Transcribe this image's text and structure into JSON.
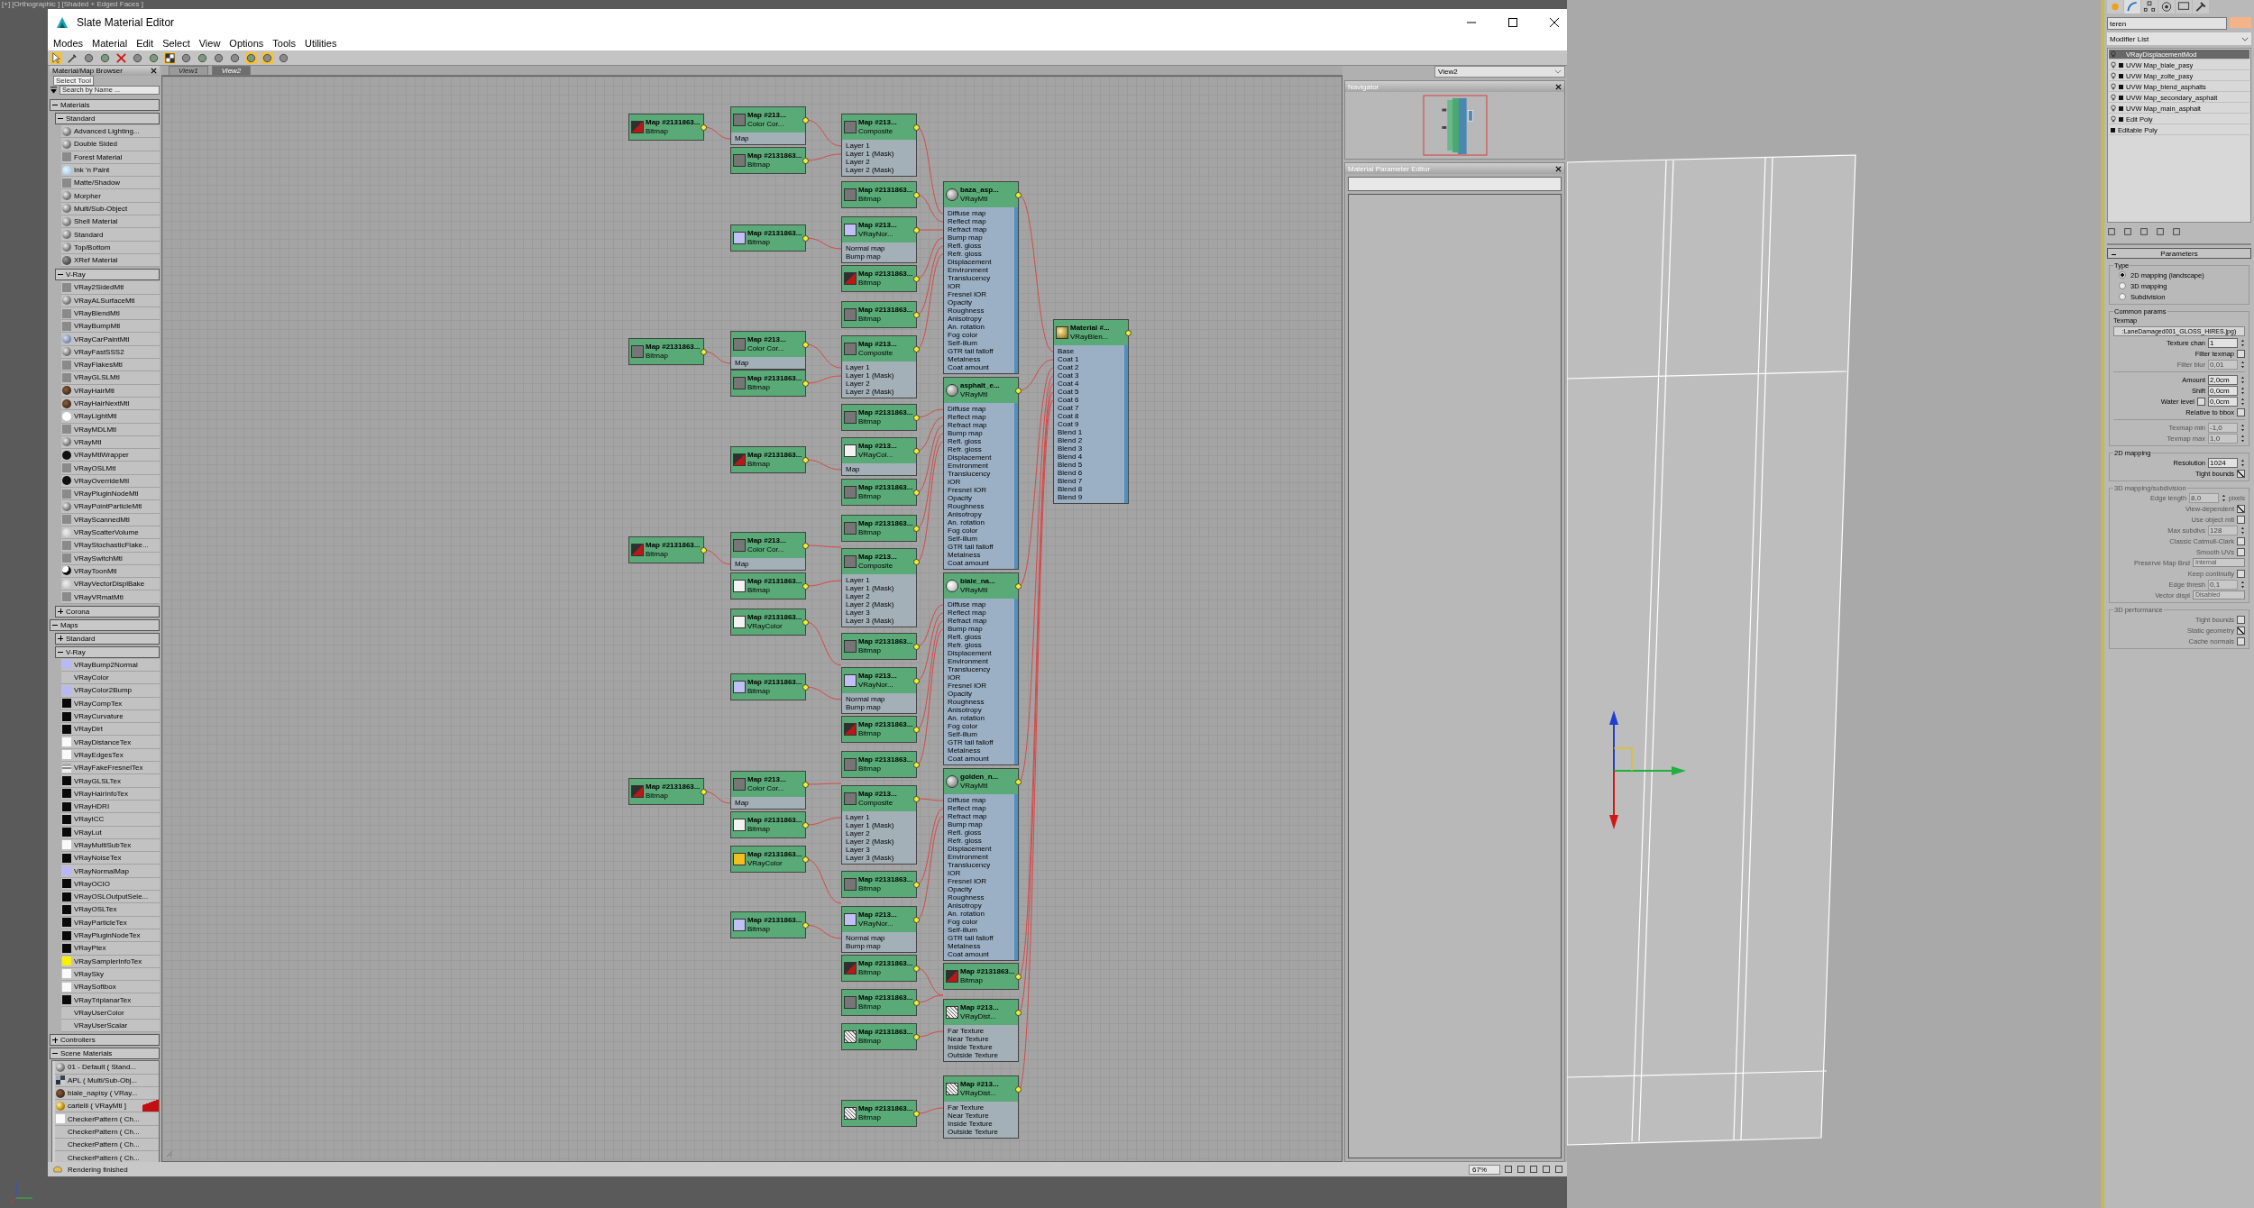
{
  "viewport": {
    "label": "[+] [Orthographic ] [Shaded + Edged Faces ]"
  },
  "window": {
    "title": "Slate Material Editor"
  },
  "menu": [
    "Modes",
    "Material",
    "Edit",
    "Select",
    "View",
    "Options",
    "Tools",
    "Utilities"
  ],
  "tooltip": "Select Tool",
  "browser": {
    "title": "Material/Map Browser",
    "search": {
      "placeholder": "Search by Name ..."
    },
    "sections": [
      {
        "label": "Materials",
        "expanded": true,
        "groups": [
          {
            "label": "Standard",
            "expanded": true,
            "items": [
              {
                "label": "Advanced Lighting...",
                "kind": "sphere"
              },
              {
                "label": "Double Sided",
                "kind": "sphere"
              },
              {
                "label": "Forest Material",
                "kind": "flat"
              },
              {
                "label": "Ink 'n Paint",
                "kind": "ink"
              },
              {
                "label": "Matte/Shadow",
                "kind": "flat"
              },
              {
                "label": "Morpher",
                "kind": "sphere"
              },
              {
                "label": "Multi/Sub-Object",
                "kind": "sphere"
              },
              {
                "label": "Shell Material",
                "kind": "sphere"
              },
              {
                "label": "Standard",
                "kind": "sphere"
              },
              {
                "label": "Top/Bottom",
                "kind": "sphere"
              },
              {
                "label": "XRef Material",
                "kind": "dark"
              }
            ]
          },
          {
            "label": "V-Ray",
            "expanded": true,
            "items": [
              {
                "label": "VRay2SidedMtl",
                "kind": "flat"
              },
              {
                "label": "VRayALSurfaceMtl",
                "kind": "sphere"
              },
              {
                "label": "VRayBlendMtl",
                "kind": "flat"
              },
              {
                "label": "VRayBumpMtl",
                "kind": "flat"
              },
              {
                "label": "VRayCarPaintMtl",
                "kind": "carpaint"
              },
              {
                "label": "VRayFastSSS2",
                "kind": "sphere"
              },
              {
                "label": "VRayFlakesMtl",
                "kind": "flat"
              },
              {
                "label": "VRayGLSLMtl",
                "kind": "flat"
              },
              {
                "label": "VRayHairMtl",
                "kind": "hair"
              },
              {
                "label": "VRayHairNextMtl",
                "kind": "hair"
              },
              {
                "label": "VRayLightMtl",
                "kind": "whitesphere"
              },
              {
                "label": "VRayMDLMtl",
                "kind": "flat"
              },
              {
                "label": "VRayMtl",
                "kind": "sphere"
              },
              {
                "label": "VRayMtlWrapper",
                "kind": "blacksphere"
              },
              {
                "label": "VRayOSLMtl",
                "kind": "flat"
              },
              {
                "label": "VRayOverrideMtl",
                "kind": "blacksphere"
              },
              {
                "label": "VRayPluginNodeMtl",
                "kind": "flat"
              },
              {
                "label": "VRayPointParticleMtl",
                "kind": "sphere"
              },
              {
                "label": "VRayScannedMtl",
                "kind": "flat"
              },
              {
                "label": "VRayScatterVolume",
                "kind": "palesphere"
              },
              {
                "label": "VRayStochasticFlake...",
                "kind": "flat"
              },
              {
                "label": "VRaySwitchMtl",
                "kind": "flat"
              },
              {
                "label": "VRayToonMtl",
                "kind": "toon"
              },
              {
                "label": "VRayVectorDisplBake",
                "kind": "palesphere"
              },
              {
                "label": "VRayVRmatMtl",
                "kind": "flat"
              }
            ]
          },
          {
            "label": "Corona",
            "expanded": false
          }
        ]
      },
      {
        "label": "Maps",
        "expanded": true,
        "groups": [
          {
            "label": "Standard",
            "expanded": false
          },
          {
            "label": "V-Ray",
            "expanded": true,
            "items": [
              {
                "label": "VRayBump2Normal",
                "kind": "lilac"
              },
              {
                "label": "VRayColor",
                "kind": "none"
              },
              {
                "label": "VRayColor2Bump",
                "kind": "lilac"
              },
              {
                "label": "VRayCompTex",
                "kind": "black"
              },
              {
                "label": "VRayCurvature",
                "kind": "black"
              },
              {
                "label": "VRayDirt",
                "kind": "black"
              },
              {
                "label": "VRayDistanceTex",
                "kind": "white"
              },
              {
                "label": "VRayEdgesTex",
                "kind": "white"
              },
              {
                "label": "VRayFakeFresnelTex",
                "kind": "stripe"
              },
              {
                "label": "VRayGLSLTex",
                "kind": "black"
              },
              {
                "label": "VRayHairInfoTex",
                "kind": "black"
              },
              {
                "label": "VRayHDRI",
                "kind": "black"
              },
              {
                "label": "VRayICC",
                "kind": "black"
              },
              {
                "label": "VRayLut",
                "kind": "black"
              },
              {
                "label": "VRayMultiSubTex",
                "kind": "white"
              },
              {
                "label": "VRayNoiseTex",
                "kind": "black"
              },
              {
                "label": "VRayNormalMap",
                "kind": "lilac"
              },
              {
                "label": "VRayOCIO",
                "kind": "black"
              },
              {
                "label": "VRayOSLOutputSele...",
                "kind": "black"
              },
              {
                "label": "VRayOSLTex",
                "kind": "black"
              },
              {
                "label": "VRayParticleTex",
                "kind": "black"
              },
              {
                "label": "VRayPluginNodeTex",
                "kind": "black"
              },
              {
                "label": "VRayPtex",
                "kind": "black"
              },
              {
                "label": "VRaySamplerInfoTex",
                "kind": "yellow"
              },
              {
                "label": "VRaySky",
                "kind": "white"
              },
              {
                "label": "VRaySoftbox",
                "kind": "white"
              },
              {
                "label": "VRayTriplanarTex",
                "kind": "black"
              },
              {
                "label": "VRayUserColor",
                "kind": "none"
              },
              {
                "label": "VRayUserScalar",
                "kind": "none"
              }
            ]
          }
        ]
      },
      {
        "label": "Controllers",
        "expanded": false
      },
      {
        "label": "Scene Materials",
        "expanded": true,
        "scene": [
          {
            "label": "01 - Default  ( Stand...",
            "kind": "sphere",
            "flag": false
          },
          {
            "label": "APL  ( Multi/Sub-Obj...",
            "kind": "multi",
            "flag": false
          },
          {
            "label": "biale_napisy  ( VRay...",
            "kind": "hair",
            "flag": false
          },
          {
            "label": "cartelli  ( VRayMtl ]",
            "kind": "gold",
            "flag": true
          },
          {
            "label": "CheckerPattern  ( Ch...",
            "kind": "white",
            "flag": false
          },
          {
            "label": "CheckerPattern  ( Ch...",
            "kind": "none",
            "flag": false
          },
          {
            "label": "CheckerPattern  ( Ch...",
            "kind": "none",
            "flag": false
          },
          {
            "label": "CheckerPattern  ( Ch...",
            "kind": "none",
            "flag": false
          }
        ]
      }
    ]
  },
  "views": [
    {
      "label": "View1",
      "selected": false
    },
    {
      "label": "View2",
      "selected": true
    }
  ],
  "nodes": [
    {
      "kind": "bitmap",
      "thumbnail": {
        "kind": "red"
      },
      "title": "Map #2131863...",
      "subtitle": "Bitmap"
    },
    {
      "kind": "map",
      "thumbnail": {
        "kind": "grey"
      },
      "title": "Map #213...",
      "subtitle": "Color Cor...",
      "slots": [
        "Map"
      ]
    },
    {
      "kind": "bitmap",
      "thumbnail": {
        "kind": "grey"
      },
      "title": "Map #2131863...",
      "subtitle": "Bitmap"
    },
    {
      "kind": "map",
      "thumbnail": {
        "kind": "grey"
      },
      "title": "Map #213...",
      "subtitle": "Composite",
      "slots": [
        "Layer 1",
        "Layer 1 (Mask)",
        "Layer 2",
        "Layer 2 (Mask)"
      ]
    },
    {
      "kind": "bitmap",
      "thumbnail": {
        "kind": "grey"
      },
      "title": "Map #2131863...",
      "subtitle": "Bitmap"
    },
    {
      "kind": "bitmap",
      "thumbnail": {
        "kind": "lilac"
      },
      "title": "Map #2131863...",
      "subtitle": "Bitmap"
    },
    {
      "kind": "map",
      "thumbnail": {
        "kind": "lilac"
      },
      "title": "Map #213...",
      "subtitle": "VRayNor...",
      "slots": [
        "Normal map",
        "Bump map"
      ]
    },
    {
      "kind": "bitmap",
      "thumbnail": {
        "kind": "red"
      },
      "title": "Map #2131863...",
      "subtitle": "Bitmap"
    },
    {
      "kind": "bitmap",
      "thumbnail": {
        "kind": "grey"
      },
      "title": "Map #2131863...",
      "subtitle": "Bitmap"
    },
    {
      "kind": "material",
      "thumbnail": {
        "kind": "sphere"
      },
      "title": "baza_asp...",
      "subtitle": "VRayMtl",
      "slots": [
        "Diffuse map",
        "Reflect map",
        "Refract map",
        "Bump map",
        "Refl. gloss",
        "Refr. gloss",
        "Displacement",
        "Environment",
        "Translucency",
        "IOR",
        "Fresnel IOR",
        "Opacity",
        "Roughness",
        "Anisotropy",
        "An. rotation",
        "Fog color",
        "Self-illum",
        "GTR tail falloff",
        "Metalness",
        "Coat amount"
      ]
    },
    {
      "kind": "bitmap",
      "thumbnail": {
        "kind": "grey"
      },
      "title": "Map #2131863...",
      "subtitle": "Bitmap"
    },
    {
      "kind": "map",
      "thumbnail": {
        "kind": "grey"
      },
      "title": "Map #213...",
      "subtitle": "Color Cor...",
      "slots": [
        "Map"
      ]
    },
    {
      "kind": "bitmap",
      "thumbnail": {
        "kind": "grey"
      },
      "title": "Map #2131863...",
      "subtitle": "Bitmap"
    },
    {
      "kind": "map",
      "thumbnail": {
        "kind": "grey"
      },
      "title": "Map #213...",
      "subtitle": "Composite",
      "slots": [
        "Layer 1",
        "Layer 1 (Mask)",
        "Layer 2",
        "Layer 2 (Mask)"
      ]
    },
    {
      "kind": "bitmap",
      "thumbnail": {
        "kind": "grey"
      },
      "title": "Map #2131863...",
      "subtitle": "Bitmap"
    },
    {
      "kind": "bitmap",
      "thumbnail": {
        "kind": "red"
      },
      "title": "Map #2131863...",
      "subtitle": "Bitmap"
    },
    {
      "kind": "map",
      "thumbnail": {
        "kind": "white"
      },
      "title": "Map #213...",
      "subtitle": "VRayCol...",
      "slots": [
        "Map"
      ]
    },
    {
      "kind": "bitmap",
      "thumbnail": {
        "kind": "grey"
      },
      "title": "Map #2131863...",
      "subtitle": "Bitmap"
    },
    {
      "kind": "bitmap",
      "thumbnail": {
        "kind": "grey"
      },
      "title": "Map #2131863...",
      "subtitle": "Bitmap"
    },
    {
      "kind": "material",
      "thumbnail": {
        "kind": "sphere"
      },
      "title": "asphalt_e...",
      "subtitle": "VRayMtl",
      "slots": [
        "Diffuse map",
        "Reflect map",
        "Refract map",
        "Bump map",
        "Refl. gloss",
        "Refr. gloss",
        "Displacement",
        "Environment",
        "Translucency",
        "IOR",
        "Fresnel IOR",
        "Opacity",
        "Roughness",
        "Anisotropy",
        "An. rotation",
        "Fog color",
        "Self-illum",
        "GTR tail falloff",
        "Metalness",
        "Coat amount"
      ]
    },
    {
      "kind": "bitmap",
      "thumbnail": {
        "kind": "red"
      },
      "title": "Map #2131863...",
      "subtitle": "Bitmap"
    },
    {
      "kind": "map",
      "thumbnail": {
        "kind": "grey"
      },
      "title": "Map #213...",
      "subtitle": "Color Cor...",
      "slots": [
        "Map"
      ]
    },
    {
      "kind": "bitmap",
      "thumbnail": {
        "kind": "white"
      },
      "title": "Map #2131863...",
      "subtitle": "Bitmap"
    },
    {
      "kind": "bitmap",
      "thumbnail": {
        "kind": "white"
      },
      "title": "Map #2131863...",
      "subtitle": "VRayColor"
    },
    {
      "kind": "map",
      "thumbnail": {
        "kind": "grey"
      },
      "title": "Map #213...",
      "subtitle": "Composite",
      "slots": [
        "Layer 1",
        "Layer 1 (Mask)",
        "Layer 2",
        "Layer 2 (Mask)",
        "Layer 3",
        "Layer 3 (Mask)"
      ]
    },
    {
      "kind": "bitmap",
      "thumbnail": {
        "kind": "grey"
      },
      "title": "Map #2131863...",
      "subtitle": "Bitmap"
    },
    {
      "kind": "bitmap",
      "thumbnail": {
        "kind": "lilac"
      },
      "title": "Map #2131863...",
      "subtitle": "Bitmap"
    },
    {
      "kind": "map",
      "thumbnail": {
        "kind": "lilac"
      },
      "title": "Map #213...",
      "subtitle": "VRayNor...",
      "slots": [
        "Normal map",
        "Bump map"
      ]
    },
    {
      "kind": "bitmap",
      "thumbnail": {
        "kind": "red"
      },
      "title": "Map #2131863...",
      "subtitle": "Bitmap"
    },
    {
      "kind": "bitmap",
      "thumbnail": {
        "kind": "grey"
      },
      "title": "Map #2131863...",
      "subtitle": "Bitmap"
    },
    {
      "kind": "material",
      "thumbnail": {
        "kind": "whitesphere"
      },
      "title": "biale_na...",
      "subtitle": "VRayMtl",
      "slots": [
        "Diffuse map",
        "Reflect map",
        "Refract map",
        "Bump map",
        "Refl. gloss",
        "Refr. gloss",
        "Displacement",
        "Environment",
        "Translucency",
        "IOR",
        "Fresnel IOR",
        "Opacity",
        "Roughness",
        "Anisotropy",
        "An. rotation",
        "Fog color",
        "Self-illum",
        "GTR tail falloff",
        "Metalness",
        "Coat amount"
      ]
    },
    {
      "kind": "bitmap",
      "thumbnail": {
        "kind": "red"
      },
      "title": "Map #2131863...",
      "subtitle": "Bitmap"
    },
    {
      "kind": "map",
      "thumbnail": {
        "kind": "grey"
      },
      "title": "Map #213...",
      "subtitle": "Color Cor...",
      "slots": [
        "Map"
      ]
    },
    {
      "kind": "bitmap",
      "thumbnail": {
        "kind": "white"
      },
      "title": "Map #2131863...",
      "subtitle": "Bitmap"
    },
    {
      "kind": "bitmap",
      "thumbnail": {
        "kind": "yellow"
      },
      "title": "Map #2131863...",
      "subtitle": "VRayColor"
    },
    {
      "kind": "map",
      "thumbnail": {
        "kind": "grey"
      },
      "title": "Map #213...",
      "subtitle": "Composite",
      "slots": [
        "Layer 1",
        "Layer 1 (Mask)",
        "Layer 2",
        "Layer 2 (Mask)",
        "Layer 3",
        "Layer 3 (Mask)"
      ]
    },
    {
      "kind": "bitmap",
      "thumbnail": {
        "kind": "grey"
      },
      "title": "Map #2131863...",
      "subtitle": "Bitmap"
    },
    {
      "kind": "bitmap",
      "thumbnail": {
        "kind": "lilac"
      },
      "title": "Map #2131863...",
      "subtitle": "Bitmap"
    },
    {
      "kind": "map",
      "thumbnail": {
        "kind": "lilac"
      },
      "title": "Map #213...",
      "subtitle": "VRayNor...",
      "slots": [
        "Normal map",
        "Bump map"
      ]
    },
    {
      "kind": "bitmap",
      "thumbnail": {
        "kind": "red"
      },
      "title": "Map #2131863...",
      "subtitle": "Bitmap"
    },
    {
      "kind": "bitmap",
      "thumbnail": {
        "kind": "grey"
      },
      "title": "Map #2131863...",
      "subtitle": "Bitmap"
    },
    {
      "kind": "material",
      "thumbnail": {
        "kind": "sphere"
      },
      "title": "golden_n...",
      "subtitle": "VRayMtl",
      "slots": [
        "Diffuse map",
        "Reflect map",
        "Refract map",
        "Bump map",
        "Refl. gloss",
        "Refr. gloss",
        "Displacement",
        "Environment",
        "Translucency",
        "IOR",
        "Fresnel IOR",
        "Opacity",
        "Roughness",
        "Anisotropy",
        "An. rotation",
        "Fog color",
        "Self-illum",
        "GTR tail falloff",
        "Metalness",
        "Coat amount"
      ]
    },
    {
      "kind": "bitmap",
      "thumbnail": {
        "kind": "red"
      },
      "title": "Map #2131863...",
      "subtitle": "Bitmap"
    },
    {
      "kind": "bitmap",
      "thumbnail": {
        "kind": "noise"
      },
      "title": "Map #2131863...",
      "subtitle": "Bitmap"
    },
    {
      "kind": "map",
      "thumbnail": {
        "kind": "noise"
      },
      "title": "Map #213...",
      "subtitle": "VRayDist...",
      "slots": [
        "Far Texture",
        "Near Texture",
        "Inside Texture",
        "Outside Texture"
      ]
    },
    {
      "kind": "bitmap",
      "thumbnail": {
        "kind": "noise"
      },
      "title": "Map #2131863...",
      "subtitle": "Bitmap"
    },
    {
      "kind": "map",
      "thumbnail": {
        "kind": "noise"
      },
      "title": "Map #213...",
      "subtitle": "VRayDist...",
      "slots": [
        "Far Texture",
        "Near Texture",
        "Inside Texture",
        "Outside Texture"
      ]
    },
    {
      "kind": "blend",
      "thumbnail": {
        "kind": "gold"
      },
      "title": "Material #...",
      "subtitle": "VRayBlen...",
      "slots": [
        "Base",
        "Coat 1",
        "Coat 2",
        "Coat 3",
        "Coat 4",
        "Coat 5",
        "Coat 6",
        "Coat 7",
        "Coat 8",
        "Coat 9",
        "Blend 1",
        "Blend 2",
        "Blend 3",
        "Blend 4",
        "Blend 5",
        "Blend 6",
        "Blend 7",
        "Blend 8",
        "Blend 9"
      ]
    }
  ],
  "view_select": "View2",
  "navigator": {
    "title": "Navigator"
  },
  "param_editor": {
    "title": "Material Parameter Editor"
  },
  "status_bar": {
    "text": "Rendering finished",
    "zoom": "67%"
  },
  "command_panel": {
    "object_name": "teren",
    "modifier_list": "Modifier List",
    "stack": [
      {
        "label": "VRayDisplacementMod",
        "selected": true,
        "bulb": true,
        "box": false
      },
      {
        "label": "UVW Map_biale_pasy",
        "selected": false,
        "bulb": true,
        "box": true
      },
      {
        "label": "UVW Map_zolte_pasy",
        "selected": false,
        "bulb": true,
        "box": true
      },
      {
        "label": "UVW Map_blend_asphalts",
        "selected": false,
        "bulb": true,
        "box": true
      },
      {
        "label": "UVW Map_secondary_asphalt",
        "selected": false,
        "bulb": true,
        "box": true
      },
      {
        "label": "UVW Map_main_asphalt",
        "selected": false,
        "bulb": true,
        "box": true
      },
      {
        "label": "Edit Poly",
        "selected": false,
        "bulb": true,
        "box": true
      },
      {
        "label": "Editable Poly",
        "selected": false,
        "bulb": false,
        "box": true
      }
    ],
    "rollout": "Parameters",
    "type_group": {
      "label": "Type",
      "options": [
        {
          "label": "2D mapping (landscape)",
          "selected": true
        },
        {
          "label": "3D mapping",
          "selected": false
        },
        {
          "label": "Subdivision",
          "selected": false
        }
      ]
    },
    "groups": [
      {
        "label": "Common params",
        "disabled": false,
        "rows": [
          {
            "kind": "caption",
            "label": "Texmap"
          },
          {
            "kind": "button",
            "label": ":LaneDamaged001_GLOSS_HIRES.jpg)"
          },
          {
            "kind": "spinner",
            "label": "Texture chan",
            "value": "1",
            "disabled": false
          },
          {
            "kind": "check",
            "label": "Filter texmap",
            "checked": false,
            "disabled": false
          },
          {
            "kind": "spinner",
            "label": "Filter blur",
            "value": "0,01",
            "disabled": true
          },
          {
            "kind": "rule"
          },
          {
            "kind": "spinner",
            "label": "Amount",
            "value": "2,0cm",
            "disabled": false
          },
          {
            "kind": "spinner",
            "label": "Shift",
            "value": "0,0cm",
            "disabled": false
          },
          {
            "kind": "checkspinner",
            "label": "Water level",
            "value": "0,0cm",
            "checked": false,
            "disabled": false
          },
          {
            "kind": "check",
            "label": "Relative to bbox",
            "checked": false,
            "disabled": false
          },
          {
            "kind": "rule"
          },
          {
            "kind": "spinner",
            "label": "Texmap min",
            "value": "-1,0",
            "disabled": true
          },
          {
            "kind": "spinner",
            "label": "Texmap max",
            "value": "1,0",
            "disabled": true
          }
        ]
      },
      {
        "label": "2D mapping",
        "disabled": false,
        "rows": [
          {
            "kind": "spinner",
            "label": "Resolution",
            "value": "1024",
            "disabled": false
          },
          {
            "kind": "check",
            "label": "Tight bounds",
            "checked": true,
            "disabled": false
          }
        ]
      },
      {
        "label": "3D mapping/subdivision",
        "disabled": true,
        "rows": [
          {
            "kind": "spinner",
            "label": "Edge length",
            "value": "8,0",
            "unit": "pixels",
            "disabled": true
          },
          {
            "kind": "check",
            "label": "View-dependent",
            "checked": true,
            "disabled": true
          },
          {
            "kind": "check",
            "label": "Use object mtl",
            "checked": false,
            "disabled": true
          },
          {
            "kind": "spinner",
            "label": "Max subdivs",
            "value": "128",
            "disabled": true
          },
          {
            "kind": "check",
            "label": "Classic Catmull-Clark",
            "checked": false,
            "disabled": true
          },
          {
            "kind": "check",
            "label": "Smooth UVs",
            "checked": false,
            "disabled": true
          },
          {
            "kind": "dropdown",
            "label": "Preserve Map Bnd",
            "value": "Internal",
            "disabled": true
          },
          {
            "kind": "check",
            "label": "Keep continuity",
            "checked": false,
            "disabled": true
          },
          {
            "kind": "spinner",
            "label": "Edge thresh",
            "value": "0,1",
            "disabled": true
          },
          {
            "kind": "dropdown",
            "label": "Vector displ",
            "value": "Disabled",
            "disabled": true
          }
        ]
      },
      {
        "label": "3D performance",
        "disabled": true,
        "rows": [
          {
            "kind": "check",
            "label": "Tight bounds",
            "checked": false,
            "disabled": true
          },
          {
            "kind": "check",
            "label": "Static geometry",
            "checked": true,
            "disabled": true
          },
          {
            "kind": "check",
            "label": "Cache normals",
            "checked": false,
            "disabled": true
          }
        ]
      }
    ]
  }
}
